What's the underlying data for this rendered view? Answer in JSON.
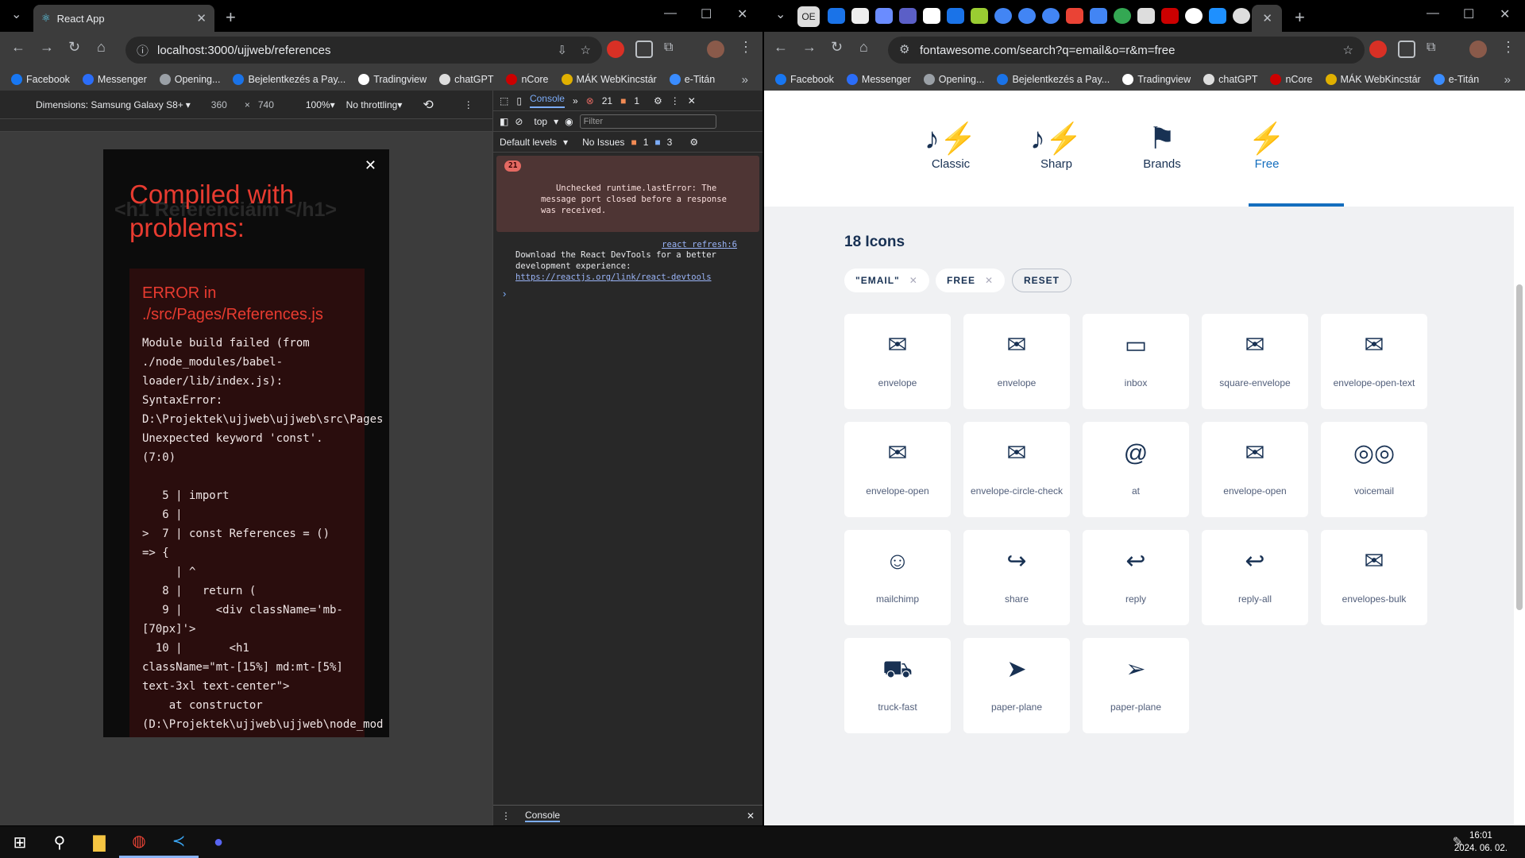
{
  "left": {
    "tab": {
      "title": "React App"
    },
    "url": "localhost:3000/ujjweb/references",
    "bookmarks": [
      "Facebook",
      "Messenger",
      "Opening...",
      "Bejelentkezés a Pay...",
      "Tradingview",
      "chatGPT",
      "nCore",
      "MÁK WebKincstár",
      "e-Titán"
    ],
    "device": {
      "label": "Dimensions: Samsung Galaxy S8+",
      "width": "360",
      "height": "740",
      "zoom": "100%",
      "throttle": "No throttling"
    },
    "overlay": {
      "title": "Compiled with problems:",
      "ghost": "<h1  Referenciáim </h1>",
      "error_title": "ERROR in ./src/Pages/References.js",
      "error_body": "Module build failed (from\n./node_modules/babel-\nloader/lib/index.js):\nSyntaxError:\nD:\\Projektek\\ujjweb\\ujjweb\\src\\Pages\nUnexpected keyword 'const'.\n(7:0)\n\n   5 | import\n   6 |\n>  7 | const References = ()\n=> {\n     | ^\n   8 |   return (\n   9 |     <div className='mb-\n[70px]'>\n  10 |       <h1\nclassName=\"mt-[15%] md:mt-[5%]\ntext-3xl text-center\">\n    at constructor\n(D:\\Projektek\\ujjweb\\ujjweb\\node_mod"
    },
    "devtools": {
      "tab": "Console",
      "errors": "21",
      "warnings": "1",
      "context": "top",
      "filter_placeholder": "Filter",
      "levels": "Default levels",
      "issues": "No Issues",
      "issue_warn": "1",
      "issue_info": "3",
      "err_badge": "21",
      "err_msg": "Unchecked runtime.lastError: The\nmessage port closed before a response\nwas received.",
      "src": "react refresh:6",
      "info_msg": "Download the React DevTools for a better\ndevelopment experience:",
      "info_link": "https://reactjs.org/link/react-devtools",
      "drawer_tab": "Console"
    }
  },
  "right": {
    "url": "fontawesome.com/search?q=email&o=r&m=free",
    "tab_glyphs": [
      "OE"
    ],
    "bookmarks": [
      "Facebook",
      "Messenger",
      "Opening...",
      "Bejelentkezés a Pay...",
      "Tradingview",
      "chatGPT",
      "nCore",
      "MÁK WebKincstár",
      "e-Titán"
    ],
    "styles": [
      {
        "label": "Classic",
        "glyph": "♪⚡"
      },
      {
        "label": "Sharp",
        "glyph": "♪⚡"
      },
      {
        "label": "Brands",
        "glyph": "⚑"
      },
      {
        "label": "Free",
        "glyph": "⚡"
      }
    ],
    "count": "18 Icons",
    "filters": [
      "\"EMAIL\"",
      "FREE"
    ],
    "reset": "RESET",
    "icons": [
      {
        "name": "envelope",
        "glyph": "✉"
      },
      {
        "name": "envelope",
        "glyph": "✉"
      },
      {
        "name": "inbox",
        "glyph": "▭"
      },
      {
        "name": "square-envelope",
        "glyph": "✉"
      },
      {
        "name": "envelope-open-text",
        "glyph": "✉"
      },
      {
        "name": "envelope-open",
        "glyph": "✉"
      },
      {
        "name": "envelope-circle-check",
        "glyph": "✉"
      },
      {
        "name": "at",
        "glyph": "@"
      },
      {
        "name": "envelope-open",
        "glyph": "✉"
      },
      {
        "name": "voicemail",
        "glyph": "◎◎"
      },
      {
        "name": "mailchimp",
        "glyph": "☺"
      },
      {
        "name": "share",
        "glyph": "↪"
      },
      {
        "name": "reply",
        "glyph": "↩"
      },
      {
        "name": "reply-all",
        "glyph": "↩"
      },
      {
        "name": "envelopes-bulk",
        "glyph": "✉"
      },
      {
        "name": "truck-fast",
        "glyph": "⛟"
      },
      {
        "name": "paper-plane",
        "glyph": "➤"
      },
      {
        "name": "paper-plane",
        "glyph": "➢"
      }
    ]
  },
  "taskbar": {
    "time": "16:01",
    "date": "2024. 06. 02."
  }
}
